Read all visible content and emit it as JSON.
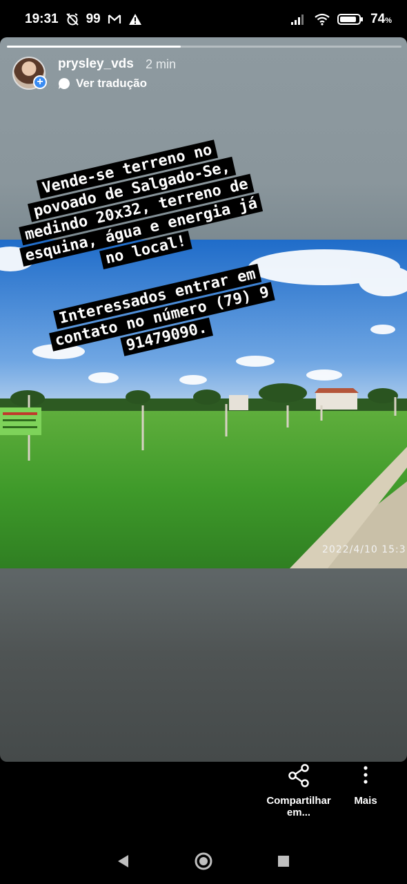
{
  "status_bar": {
    "time": "19:31",
    "badge_count": "99",
    "battery": "74",
    "battery_unit": "%",
    "icons": [
      "alarm-off-icon",
      "gmail-icon",
      "warning-icon",
      "signal-icon",
      "wifi-icon",
      "battery-icon"
    ]
  },
  "story": {
    "progress_fraction": 0.44,
    "username": "prysley_vds",
    "time_ago": "2 min",
    "translate_label": "Ver tradução",
    "text_block_1": "Vende-se terreno no povoado de Salgado-Se, medindo 20x32, terreno de esquina, água e energia já no local!",
    "text_block_2": "Interessados entrar em contato no número (79) 9 91479090.",
    "photo_timestamp": "2022/4/10 15:3"
  },
  "actions": {
    "share_label": "Compartilhar em...",
    "more_label": "Mais"
  },
  "navbar": {
    "icons": [
      "back-icon",
      "home-icon",
      "recents-icon"
    ]
  },
  "colors": {
    "accent_blue": "#3b8cf2",
    "grass": "#3f9a2a",
    "sky": "#2f7fd8"
  }
}
